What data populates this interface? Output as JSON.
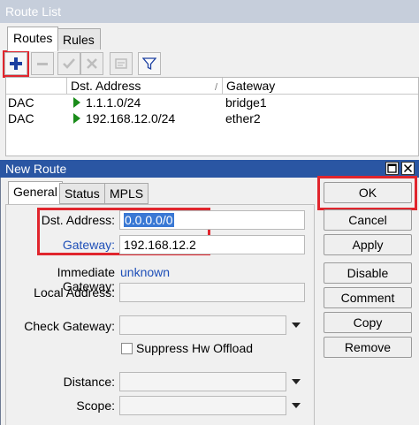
{
  "route_list": {
    "title": "Route List",
    "tabs": [
      {
        "label": "Routes"
      },
      {
        "label": "Rules"
      }
    ],
    "toolbar": {
      "add_icon": "plus-icon",
      "remove_icon": "minus-icon",
      "enable_icon": "check-icon",
      "disable_icon": "x-icon",
      "comment_icon": "comment-icon",
      "filter_icon": "filter-icon"
    },
    "columns": [
      "",
      "Dst. Address",
      "Gateway"
    ],
    "rows": [
      {
        "flags": "DAC",
        "dst": "1.1.1.0/24",
        "gateway": "bridge1"
      },
      {
        "flags": "DAC",
        "dst": "192.168.12.0/24",
        "gateway": "ether2"
      }
    ]
  },
  "new_route": {
    "title": "New Route",
    "tabs": [
      {
        "label": "General"
      },
      {
        "label": "Status"
      },
      {
        "label": "MPLS"
      }
    ],
    "fields": {
      "dst_label": "Dst. Address:",
      "dst_value": "0.0.0.0/0",
      "gateway_label": "Gateway:",
      "gateway_value": "192.168.12.2",
      "immediate_gateway_label": "Immediate Gateway:",
      "immediate_gateway_value": "unknown",
      "local_address_label": "Local Address:",
      "check_gateway_label": "Check Gateway:",
      "suppress_label": "Suppress Hw Offload",
      "distance_label": "Distance:",
      "scope_label": "Scope:"
    },
    "buttons": {
      "ok": "OK",
      "cancel": "Cancel",
      "apply": "Apply",
      "disable": "Disable",
      "comment": "Comment",
      "copy": "Copy",
      "remove": "Remove"
    }
  },
  "colors": {
    "highlight": "#e0252d",
    "title_active": "#2a56a3",
    "link": "#1e4fb8"
  }
}
